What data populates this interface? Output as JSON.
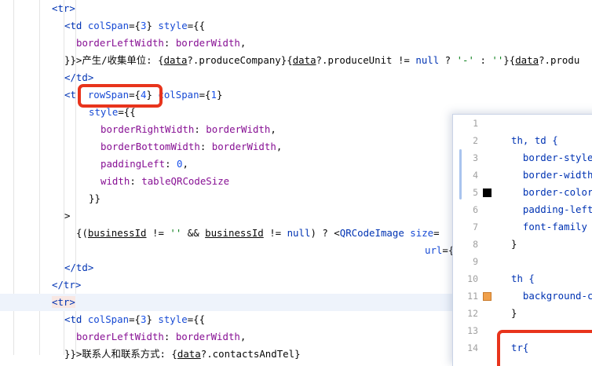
{
  "editor": {
    "lines": [
      {
        "segs": [
          {
            "t": "<tr>",
            "c": "tag"
          }
        ]
      },
      {
        "segs": [
          {
            "t": "<td ",
            "c": "tag"
          },
          {
            "t": "colSpan",
            "c": "attr"
          },
          {
            "t": "={"
          },
          {
            "t": "3",
            "c": "num"
          },
          {
            "t": "} "
          },
          {
            "t": "style",
            "c": "attr"
          },
          {
            "t": "={{"
          }
        ]
      },
      {
        "segs": [
          {
            "t": "borderLeftWidth",
            "c": "prop"
          },
          {
            "t": ": "
          },
          {
            "t": "borderWidth",
            "c": "prop"
          },
          {
            "t": ","
          }
        ]
      },
      {
        "segs": [
          {
            "t": "}}>产生/收集单位: {"
          },
          {
            "t": "data",
            "c": "ul"
          },
          {
            "t": "?.produceCompany}{"
          },
          {
            "t": "data",
            "c": "ul"
          },
          {
            "t": "?.produceUnit != "
          },
          {
            "t": "null",
            "c": "kw"
          },
          {
            "t": " ? "
          },
          {
            "t": "'-'",
            "c": "str"
          },
          {
            "t": " : "
          },
          {
            "t": "''",
            "c": "str"
          },
          {
            "t": "}{"
          },
          {
            "t": "data",
            "c": "ul"
          },
          {
            "t": "?.produ"
          }
        ]
      },
      {
        "segs": [
          {
            "t": "</td>",
            "c": "tag"
          }
        ]
      },
      {
        "segs": [
          {
            "t": "<t",
            "c": "tag"
          },
          {
            "t": "  "
          },
          {
            "t": "rowSpan",
            "c": "attr"
          },
          {
            "t": "={"
          },
          {
            "t": "4",
            "c": "num"
          },
          {
            "t": "} "
          },
          {
            "t": "colSpan",
            "c": "attr"
          },
          {
            "t": "={"
          },
          {
            "t": "1",
            "c": "num"
          },
          {
            "t": "}"
          }
        ]
      },
      {
        "segs": [
          {
            "t": "style",
            "c": "attr"
          },
          {
            "t": "={{"
          }
        ]
      },
      {
        "segs": [
          {
            "t": "borderRightWidth",
            "c": "prop"
          },
          {
            "t": ": "
          },
          {
            "t": "borderWidth",
            "c": "prop"
          },
          {
            "t": ","
          }
        ]
      },
      {
        "segs": [
          {
            "t": "borderBottomWidth",
            "c": "prop"
          },
          {
            "t": ": "
          },
          {
            "t": "borderWidth",
            "c": "prop"
          },
          {
            "t": ","
          }
        ]
      },
      {
        "segs": [
          {
            "t": "paddingLeft",
            "c": "prop"
          },
          {
            "t": ": "
          },
          {
            "t": "0",
            "c": "num"
          },
          {
            "t": ","
          }
        ]
      },
      {
        "segs": [
          {
            "t": "width",
            "c": "prop"
          },
          {
            "t": ": "
          },
          {
            "t": "tableQRCodeSize",
            "c": "prop"
          }
        ]
      },
      {
        "segs": [
          {
            "t": "}}"
          }
        ]
      },
      {
        "segs": [
          {
            "t": ">"
          }
        ]
      },
      {
        "segs": [
          {
            "t": "{("
          },
          {
            "t": "businessId",
            "c": "ul"
          },
          {
            "t": " != "
          },
          {
            "t": "''",
            "c": "str"
          },
          {
            "t": " && "
          },
          {
            "t": "businessId",
            "c": "ul"
          },
          {
            "t": " != "
          },
          {
            "t": "null",
            "c": "kw"
          },
          {
            "t": ") ? <"
          },
          {
            "t": "QRCodeImage",
            "c": "tag"
          },
          {
            "t": " "
          },
          {
            "t": "size",
            "c": "attr"
          },
          {
            "t": "="
          }
        ]
      },
      {
        "segs": [
          {
            "t": "url",
            "c": "attr"
          },
          {
            "t": "={"
          }
        ]
      },
      {
        "segs": [
          {
            "t": "</td>",
            "c": "tag"
          }
        ]
      },
      {
        "segs": [
          {
            "t": "</tr>",
            "c": "tag"
          }
        ]
      },
      {
        "segs": [
          {
            "t": "<tr>",
            "c": "tag tagbg"
          }
        ]
      },
      {
        "segs": [
          {
            "t": "<td ",
            "c": "tag"
          },
          {
            "t": "colSpan",
            "c": "attr"
          },
          {
            "t": "={"
          },
          {
            "t": "3",
            "c": "num"
          },
          {
            "t": "} "
          },
          {
            "t": "style",
            "c": "attr"
          },
          {
            "t": "={{"
          }
        ]
      },
      {
        "segs": [
          {
            "t": "borderLeftWidth",
            "c": "prop"
          },
          {
            "t": ": "
          },
          {
            "t": "borderWidth",
            "c": "prop"
          },
          {
            "t": ","
          }
        ]
      },
      {
        "segs": [
          {
            "t": "}}>联系人和联系方式: {"
          },
          {
            "t": "data",
            "c": "ul"
          },
          {
            "t": "?.contactsAndTel}"
          }
        ]
      }
    ]
  },
  "popup": {
    "lines": [
      {
        "n": "1",
        "segs": []
      },
      {
        "n": "2",
        "segs": [
          {
            "t": "th, td {",
            "c": "sel"
          }
        ]
      },
      {
        "n": "3",
        "segs": [
          {
            "t": "  border-style",
            "c": "sel"
          }
        ]
      },
      {
        "n": "4",
        "segs": [
          {
            "t": "  border-width",
            "c": "sel"
          }
        ]
      },
      {
        "n": "5",
        "segs": [
          {
            "t": "  border-color",
            "c": "sel"
          }
        ],
        "swatch": "#000000"
      },
      {
        "n": "6",
        "segs": [
          {
            "t": "  padding-left",
            "c": "sel"
          }
        ]
      },
      {
        "n": "7",
        "segs": [
          {
            "t": "  font-family",
            "c": "sel"
          }
        ]
      },
      {
        "n": "8",
        "segs": [
          {
            "t": "}"
          }
        ]
      },
      {
        "n": "9",
        "segs": []
      },
      {
        "n": "10",
        "segs": [
          {
            "t": "th {",
            "c": "sel"
          }
        ]
      },
      {
        "n": "11",
        "segs": [
          {
            "t": "  background-c",
            "c": "sel"
          }
        ],
        "swatch": "#f0a04b"
      },
      {
        "n": "12",
        "segs": [
          {
            "t": "}"
          }
        ]
      },
      {
        "n": "13",
        "segs": []
      },
      {
        "n": "14",
        "segs": [
          {
            "t": "tr{",
            "c": "sel"
          }
        ]
      }
    ]
  },
  "colors": {
    "tag": "#0033b3",
    "attr": "#174ad4",
    "prop": "#871094",
    "num": "#1750eb",
    "str": "#067d17",
    "highlight": "#e8341c"
  }
}
